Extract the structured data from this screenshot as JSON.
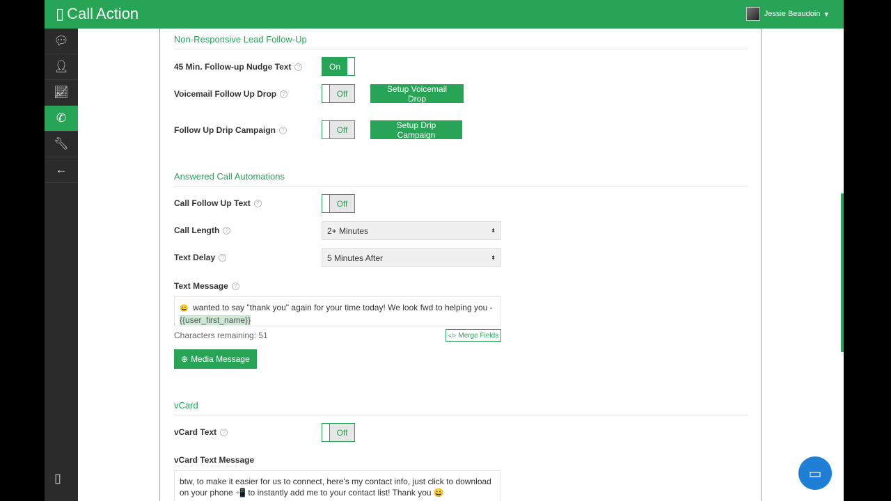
{
  "header": {
    "logo_light": "Call",
    "logo_bold": "Action",
    "user_name": "Jessie Beaudoin"
  },
  "sections": {
    "non_responsive": "Non-Responsive Lead Follow-Up",
    "answered": "Answered Call Automations",
    "vcard": "vCard"
  },
  "rows": {
    "nudge": {
      "label": "45 Min. Follow-up Nudge Text",
      "state": "On"
    },
    "voicemail": {
      "label": "Voicemail Follow Up Drop",
      "state": "Off",
      "button": "Setup Voicemail Drop"
    },
    "drip": {
      "label": "Follow Up Drip Campaign",
      "state": "Off",
      "button": "Setup Drip Campaign"
    },
    "call_followup": {
      "label": "Call Follow Up Text",
      "state": "Off"
    },
    "call_length": {
      "label": "Call Length",
      "value": "2+ Minutes"
    },
    "text_delay": {
      "label": "Text Delay",
      "value": "5 Minutes After"
    },
    "text_message": {
      "label": "Text Message",
      "emoji": "😀",
      "body": "wanted to say \"thank you\" again for your time today! We look fwd to helping you -",
      "merge_tag": "{{user_first_name}}",
      "chars_remaining": "Characters remaining: 51",
      "merge_button": "Merge Fields",
      "media_button": "Media Message"
    },
    "vcard_text": {
      "label": "vCard Text",
      "state": "Off"
    },
    "vcard_message": {
      "label": "vCard Text Message",
      "body": "btw, to make it easier for us to connect, here's my contact info, just click to download on your phone 📲  to instantly add me to your contact list! Thank you 😀"
    }
  },
  "colors": {
    "brand": "#27a456",
    "sidebar": "#2b2b2b"
  }
}
